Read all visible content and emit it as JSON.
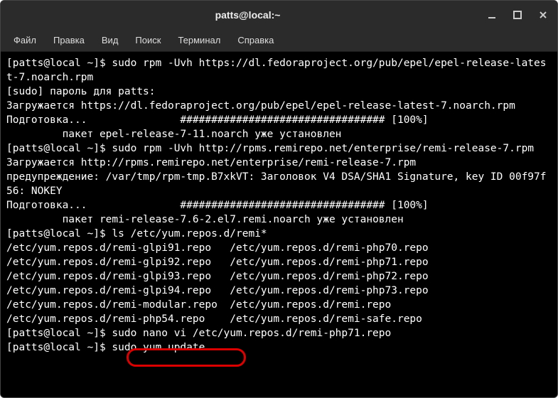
{
  "window": {
    "title": "patts@local:~"
  },
  "menu": {
    "items": {
      "file": "Файл",
      "edit": "Правка",
      "view": "Вид",
      "search": "Поиск",
      "terminal": "Терминал",
      "help": "Справка"
    }
  },
  "terminal": {
    "line1": "[patts@local ~]$ sudo rpm -Uvh https://dl.fedoraproject.org/pub/epel/epel-release-latest-7.noarch.rpm",
    "line2": "[sudo] пароль для patts:",
    "line3": "Загружается https://dl.fedoraproject.org/pub/epel/epel-release-latest-7.noarch.rpm",
    "line4": "Подготовка...               ################################# [100%]",
    "line5": "         пакет epel-release-7-11.noarch уже установлен",
    "line6": "[patts@local ~]$ sudo rpm -Uvh http://rpms.remirepo.net/enterprise/remi-release-7.rpm",
    "line7": "Загружается http://rpms.remirepo.net/enterprise/remi-release-7.rpm",
    "line8": "предупреждение: /var/tmp/rpm-tmp.B7xkVT: Заголовок V4 DSA/SHA1 Signature, key ID 00f97f56: NOKEY",
    "line9": "Подготовка...               ################################# [100%]",
    "line10": "         пакет remi-release-7.6-2.el7.remi.noarch уже установлен",
    "line11": "[patts@local ~]$ ls /etc/yum.repos.d/remi*",
    "line12": "/etc/yum.repos.d/remi-glpi91.repo   /etc/yum.repos.d/remi-php70.repo",
    "line13": "/etc/yum.repos.d/remi-glpi92.repo   /etc/yum.repos.d/remi-php71.repo",
    "line14": "/etc/yum.repos.d/remi-glpi93.repo   /etc/yum.repos.d/remi-php72.repo",
    "line15": "/etc/yum.repos.d/remi-glpi94.repo   /etc/yum.repos.d/remi-php73.repo",
    "line16": "/etc/yum.repos.d/remi-modular.repo  /etc/yum.repos.d/remi.repo",
    "line17": "/etc/yum.repos.d/remi-php54.repo    /etc/yum.repos.d/remi-safe.repo",
    "line18": "[patts@local ~]$ sudo nano vi /etc/yum.repos.d/remi-php71.repo",
    "line19": "[patts@local ~]$ sudo yum update"
  },
  "highlight": {
    "command": "sudo yum update"
  }
}
